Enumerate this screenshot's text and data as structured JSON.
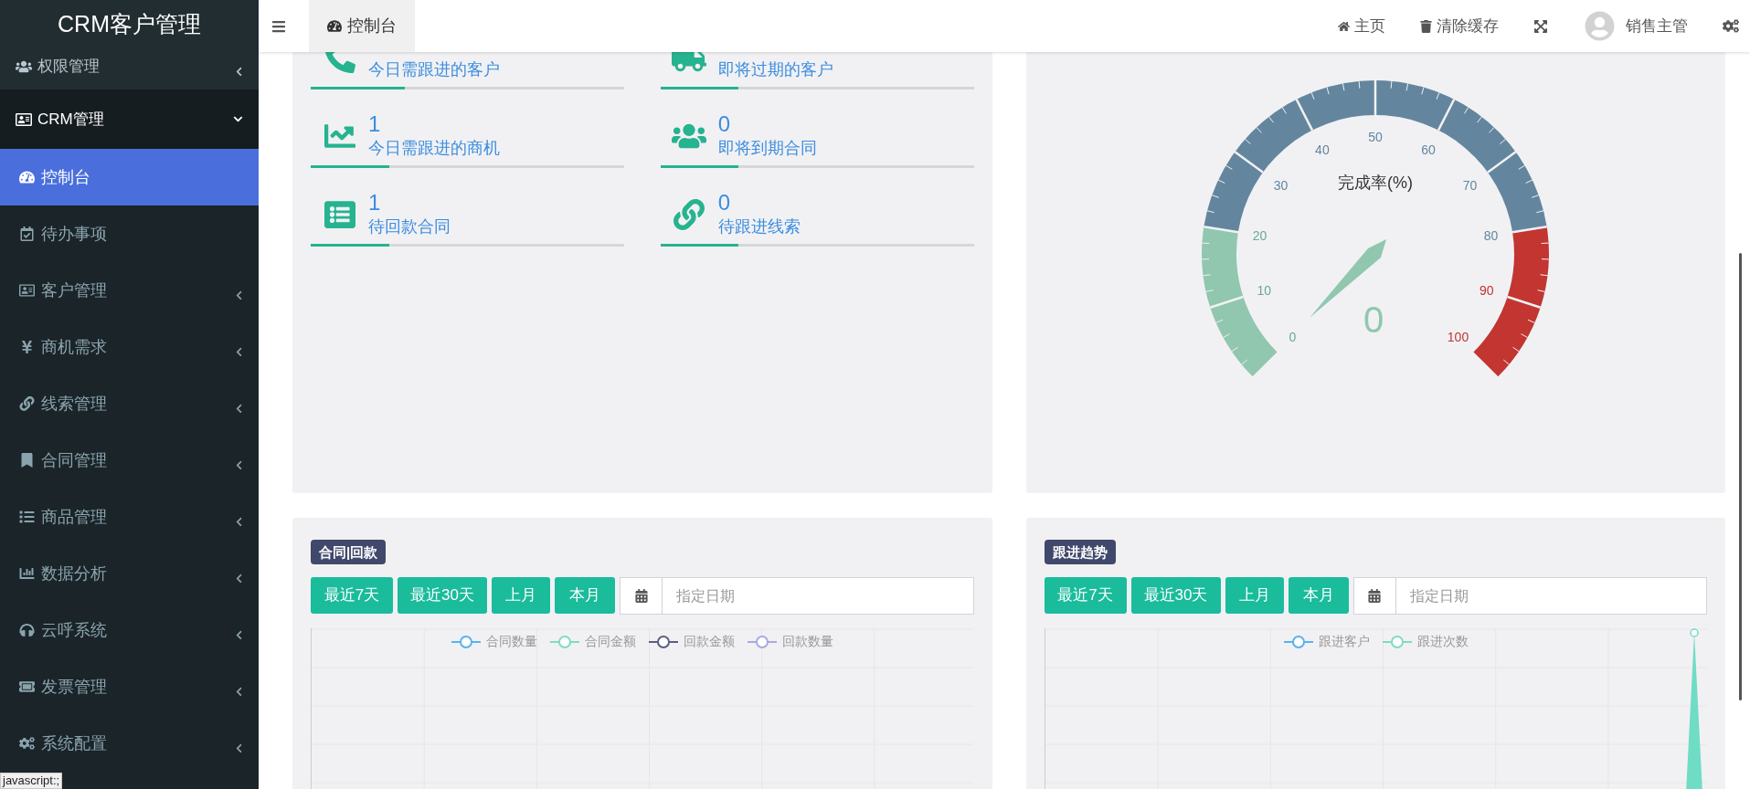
{
  "sidebar": {
    "logo": "CRM客户管理",
    "items": [
      {
        "kind": "menu",
        "label": "权限管理",
        "expanded": false
      },
      {
        "kind": "menu",
        "label": "CRM管理",
        "expanded": true,
        "children": [
          {
            "kind": "link",
            "label": "控制台",
            "selected": true
          },
          {
            "kind": "link",
            "label": "待办事项",
            "selected": false
          },
          {
            "kind": "menu",
            "label": "客户管理",
            "expanded": false,
            "selected": false
          },
          {
            "kind": "menu",
            "label": "商机需求",
            "expanded": false,
            "selected": false
          },
          {
            "kind": "menu",
            "label": "线索管理",
            "expanded": false,
            "selected": false
          },
          {
            "kind": "menu",
            "label": "合同管理",
            "expanded": false,
            "selected": false
          },
          {
            "kind": "menu",
            "label": "商品管理",
            "expanded": false,
            "selected": false
          },
          {
            "kind": "menu",
            "label": "数据分析",
            "expanded": false,
            "selected": false
          },
          {
            "kind": "menu",
            "label": "云呼系统",
            "expanded": false,
            "selected": false
          },
          {
            "kind": "menu",
            "label": "发票管理",
            "expanded": false,
            "selected": false
          },
          {
            "kind": "menu",
            "label": "系统配置",
            "expanded": false,
            "selected": false
          }
        ]
      }
    ]
  },
  "header": {
    "tabs": [
      {
        "label": "控制台",
        "selected": true
      }
    ],
    "links": [
      "主页",
      "清除缓存"
    ],
    "user": "销售主管"
  },
  "stats": [
    {
      "label": "今日需跟进的客户",
      "level": 0.3
    },
    {
      "label": "即将过期的客户",
      "level": 0.25
    },
    {
      "value": "1",
      "label": "今日需跟进的商机",
      "level": 0.25
    },
    {
      "value": "0",
      "label": "即将到期合同",
      "level": 0.25
    },
    {
      "value": "1",
      "label": "待回款合同",
      "level": 0.25
    },
    {
      "value": "0",
      "label": "待跟进线索",
      "level": 0.25
    }
  ],
  "gauge": {
    "title": "完成率(%)",
    "value": "0",
    "labels": [
      "0",
      "10",
      "20",
      "30",
      "40",
      "50",
      "60",
      "70",
      "80",
      "90",
      "100"
    ]
  },
  "panels": [
    {
      "badge": "合同|回款",
      "buttons": [
        "最近7天",
        "最近30天",
        "上月",
        "本月"
      ],
      "date_placeholder": "指定日期",
      "legend": [
        {
          "label": "合同数量",
          "color": "#5ab1ef"
        },
        {
          "label": "合同金额",
          "color": "#7fdcc0"
        },
        {
          "label": "回款金额",
          "color": "#5c5f7e"
        },
        {
          "label": "回款数量",
          "color": "#a9a9e0"
        }
      ]
    },
    {
      "badge": "跟进趋势",
      "buttons": [
        "最近7天",
        "最近30天",
        "上月",
        "本月"
      ],
      "date_placeholder": "指定日期",
      "legend": [
        {
          "label": "跟进客户",
          "color": "#5ab1ef"
        },
        {
          "label": "跟进次数",
          "color": "#7fdcc0"
        }
      ]
    }
  ],
  "status_tip": "javascript:;"
}
